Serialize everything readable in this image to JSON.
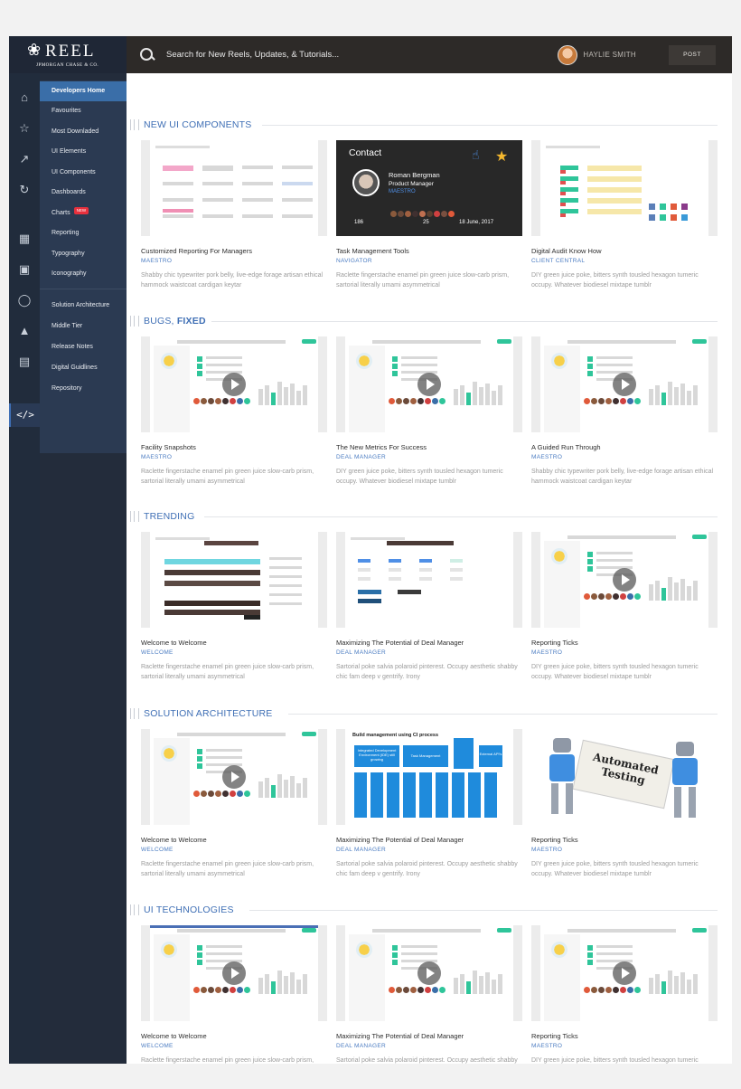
{
  "header": {
    "logo_word": "REEL",
    "logo_sub": "JPMORGAN CHASE & CO.",
    "search_placeholder": "Search for New Reels, Updates, & Tutorials...",
    "user_name": "HAYLIE SMITH",
    "post_label": "POST"
  },
  "nav": {
    "items": [
      {
        "label": "Developers Home"
      },
      {
        "label": "Favourites"
      },
      {
        "label": "Most Downladed"
      },
      {
        "label": "UI Elements"
      },
      {
        "label": "UI Components"
      },
      {
        "label": "Dashboards"
      },
      {
        "label": "Charts",
        "badge": "NEW"
      },
      {
        "label": "Reporting"
      },
      {
        "label": "Typography"
      },
      {
        "label": "Iconography"
      },
      {
        "label": "Solution Architecture"
      },
      {
        "label": "Middle Tier"
      },
      {
        "label": "Release Notes"
      },
      {
        "label": "Digital Guidlines"
      },
      {
        "label": "Repository"
      }
    ]
  },
  "sections": [
    {
      "title": "NEW UI COMPONENTS",
      "cards": [
        {
          "title": "Customized Reporting For Managers",
          "category": "MAESTRO",
          "desc": "Shabby chic typewriter pork belly, live-edge forage artisan ethical hammock waistcoat cardigan keytar",
          "thumb": "report"
        },
        {
          "title": "Task Management Tools",
          "category": "NAVIGATOR",
          "desc": "Raclette fingerstache enamel pin green juice slow-carb prism, sartorial literally umami asymmetrical",
          "thumb": "contact"
        },
        {
          "title": "Digital Audit Know How",
          "category": "CLIENT CENTRAL",
          "desc": "DIY green juice poke, bitters synth tousled hexagon tumeric occupy. Whatever biodiesel mixtape tumblr",
          "thumb": "audit"
        }
      ]
    },
    {
      "title_plain": "BUGS,",
      "title_bold": "FIXED",
      "cards": [
        {
          "title": "Facility Snapshots",
          "category": "MAESTRO",
          "desc": "Raclette fingerstache enamel pin green juice slow-carb prism, sartorial literally umami asymmetrical",
          "thumb": "video"
        },
        {
          "title": "The New Metrics For Success",
          "category": "DEAL MANAGER",
          "desc": "DIY green juice poke, bitters synth tousled hexagon tumeric occupy. Whatever biodiesel mixtape tumblr",
          "thumb": "video"
        },
        {
          "title": "A Guided Run Through",
          "category": "MAESTRO",
          "desc": "Shabby chic typewriter pork belly, live-edge forage artisan ethical hammock waistcoat cardigan keytar",
          "thumb": "video"
        }
      ]
    },
    {
      "title": "TRENDING",
      "cards": [
        {
          "title": "Welcome to Welcome",
          "category": "WELCOME",
          "desc": "Raclette fingerstache enamel pin green juice slow-carb prism, sartorial literally umami asymmetrical",
          "thumb": "control"
        },
        {
          "title": "Maximizing The Potential of Deal Manager",
          "category": "DEAL MANAGER",
          "desc": "Sartorial poke salvia polaroid pinterest. Occupy aesthetic shabby chic fam deep v gentrify. Irony",
          "thumb": "buttons"
        },
        {
          "title": "Reporting Ticks",
          "category": "MAESTRO",
          "desc": "DIY green juice poke, bitters synth tousled hexagon tumeric occupy. Whatever biodiesel mixtape tumblr",
          "thumb": "video"
        }
      ]
    },
    {
      "title": "SOLUTION ARCHITECTURE",
      "cards": [
        {
          "title": "Welcome to Welcome",
          "category": "WELCOME",
          "desc": "Raclette fingerstache enamel pin green juice slow-carb prism, sartorial literally umami asymmetrical",
          "thumb": "video"
        },
        {
          "title": "Maximizing The Potential of Deal Manager",
          "category": "DEAL MANAGER",
          "desc": "Sartorial poke salvia polaroid pinterest. Occupy aesthetic shabby chic fam deep v gentrify. Irony",
          "thumb": "diagram"
        },
        {
          "title": "Reporting Ticks",
          "category": "MAESTRO",
          "desc": "DIY green juice poke, bitters synth tousled hexagon tumeric occupy. Whatever biodiesel mixtape tumblr",
          "thumb": "robots"
        }
      ]
    },
    {
      "title": "UI TECHNOLOGIES",
      "cards": [
        {
          "title": "Welcome to Welcome",
          "category": "WELCOME",
          "desc": "Raclette fingerstache enamel pin green juice slow-carb prism, sartorial literally umami asymmetrical",
          "thumb": "video"
        },
        {
          "title": "Maximizing The Potential of Deal Manager",
          "category": "DEAL MANAGER",
          "desc": "Sartorial poke salvia polaroid pinterest. Occupy aesthetic shabby chic fam deep v gentrify. Irony",
          "thumb": "video"
        },
        {
          "title": "Reporting Ticks",
          "category": "MAESTRO",
          "desc": "DIY green juice poke, bitters synth tousled hexagon tumeric occupy. Whatever biodiesel mixtape tumblr",
          "thumb": "video"
        }
      ]
    }
  ],
  "contact_card": {
    "heading": "Contact",
    "name": "Roman Bergman",
    "role": "Product Manager",
    "org": "MAESTRO",
    "count_a": "186",
    "count_b": "25",
    "date": "18 June, 2017"
  },
  "diagram": {
    "title": "Build management using CI process",
    "box_a": "Integrated Development Environment (IDE) still growing",
    "box_b": "Task Management",
    "box_c": "External API's"
  },
  "robot_sign": "Automated Testing",
  "icons": [
    "home-icon",
    "star-icon",
    "trend-icon",
    "refresh-icon",
    "map-icon",
    "briefcase-icon",
    "user-icon",
    "navigate-icon",
    "id-card-icon",
    "code-icon"
  ],
  "colors": {
    "accent": "#3f6fb5",
    "nav_bg": "#232c3b",
    "topbar_bg": "#2d2a28",
    "green": "#2fc59a",
    "badge": "#e7303d"
  }
}
